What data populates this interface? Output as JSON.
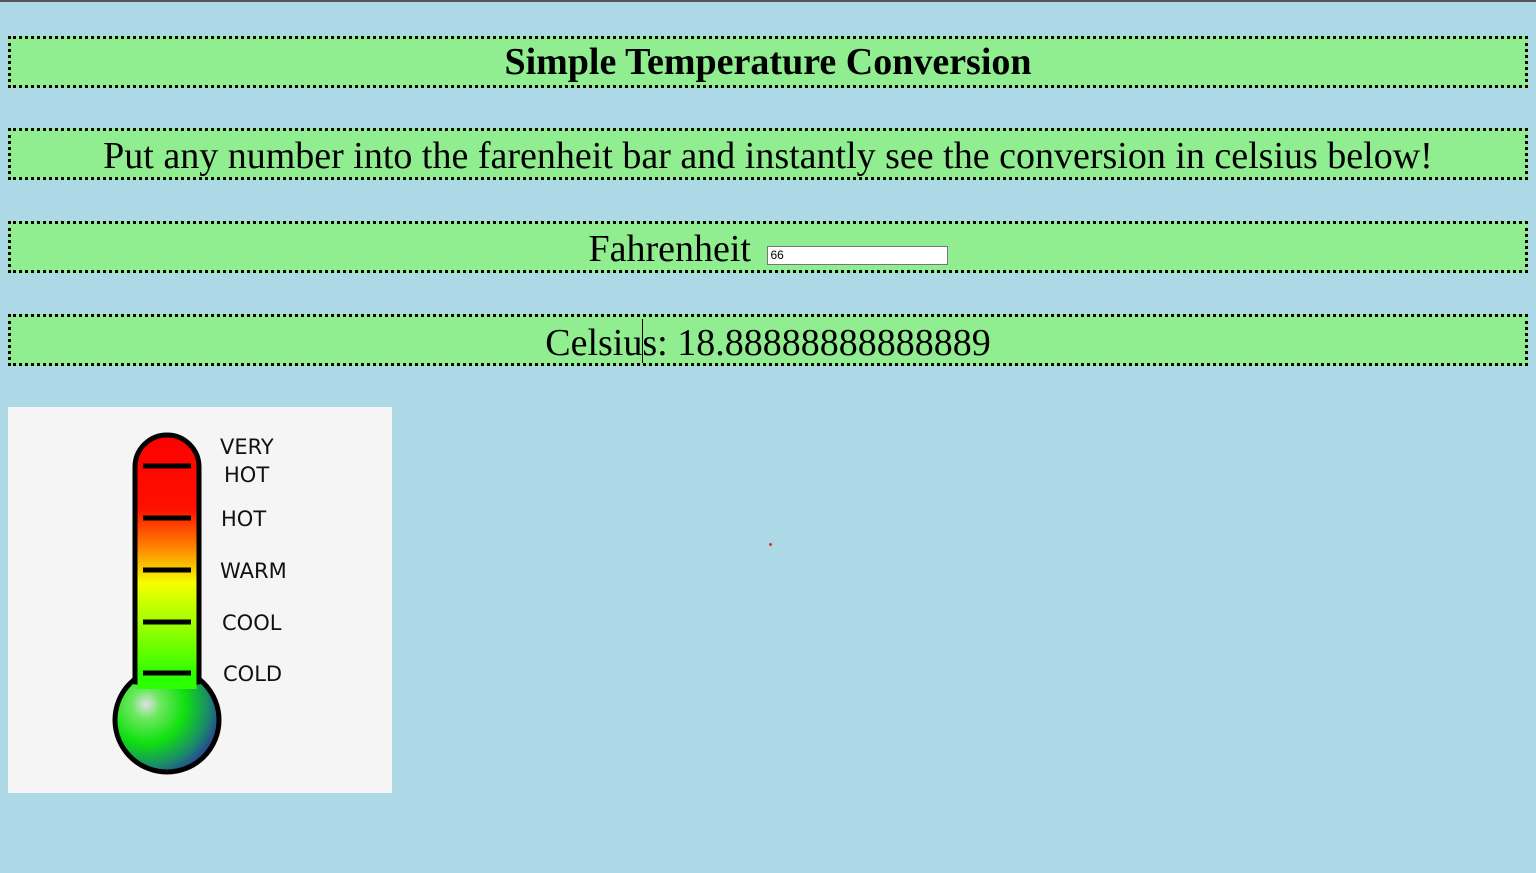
{
  "heading": "Simple Temperature Conversion",
  "description": "Put any number into the farenheit bar and instantly see the conversion in celsius below!",
  "fahrenheit": {
    "label": "Fahrenheit",
    "value": "66"
  },
  "celsius": {
    "label_part1": "Celsiu",
    "label_part2": "s:",
    "value": "18.88888888888889"
  },
  "thermometer": {
    "labels": {
      "very": "VERY",
      "hot_top": "HOT",
      "hot": "HOT",
      "warm": "WARM",
      "cool": "COOL",
      "cold": "COLD"
    }
  },
  "colors": {
    "page_background": "#add8e6",
    "box_background": "#90ee90",
    "box_border": "#000000"
  }
}
